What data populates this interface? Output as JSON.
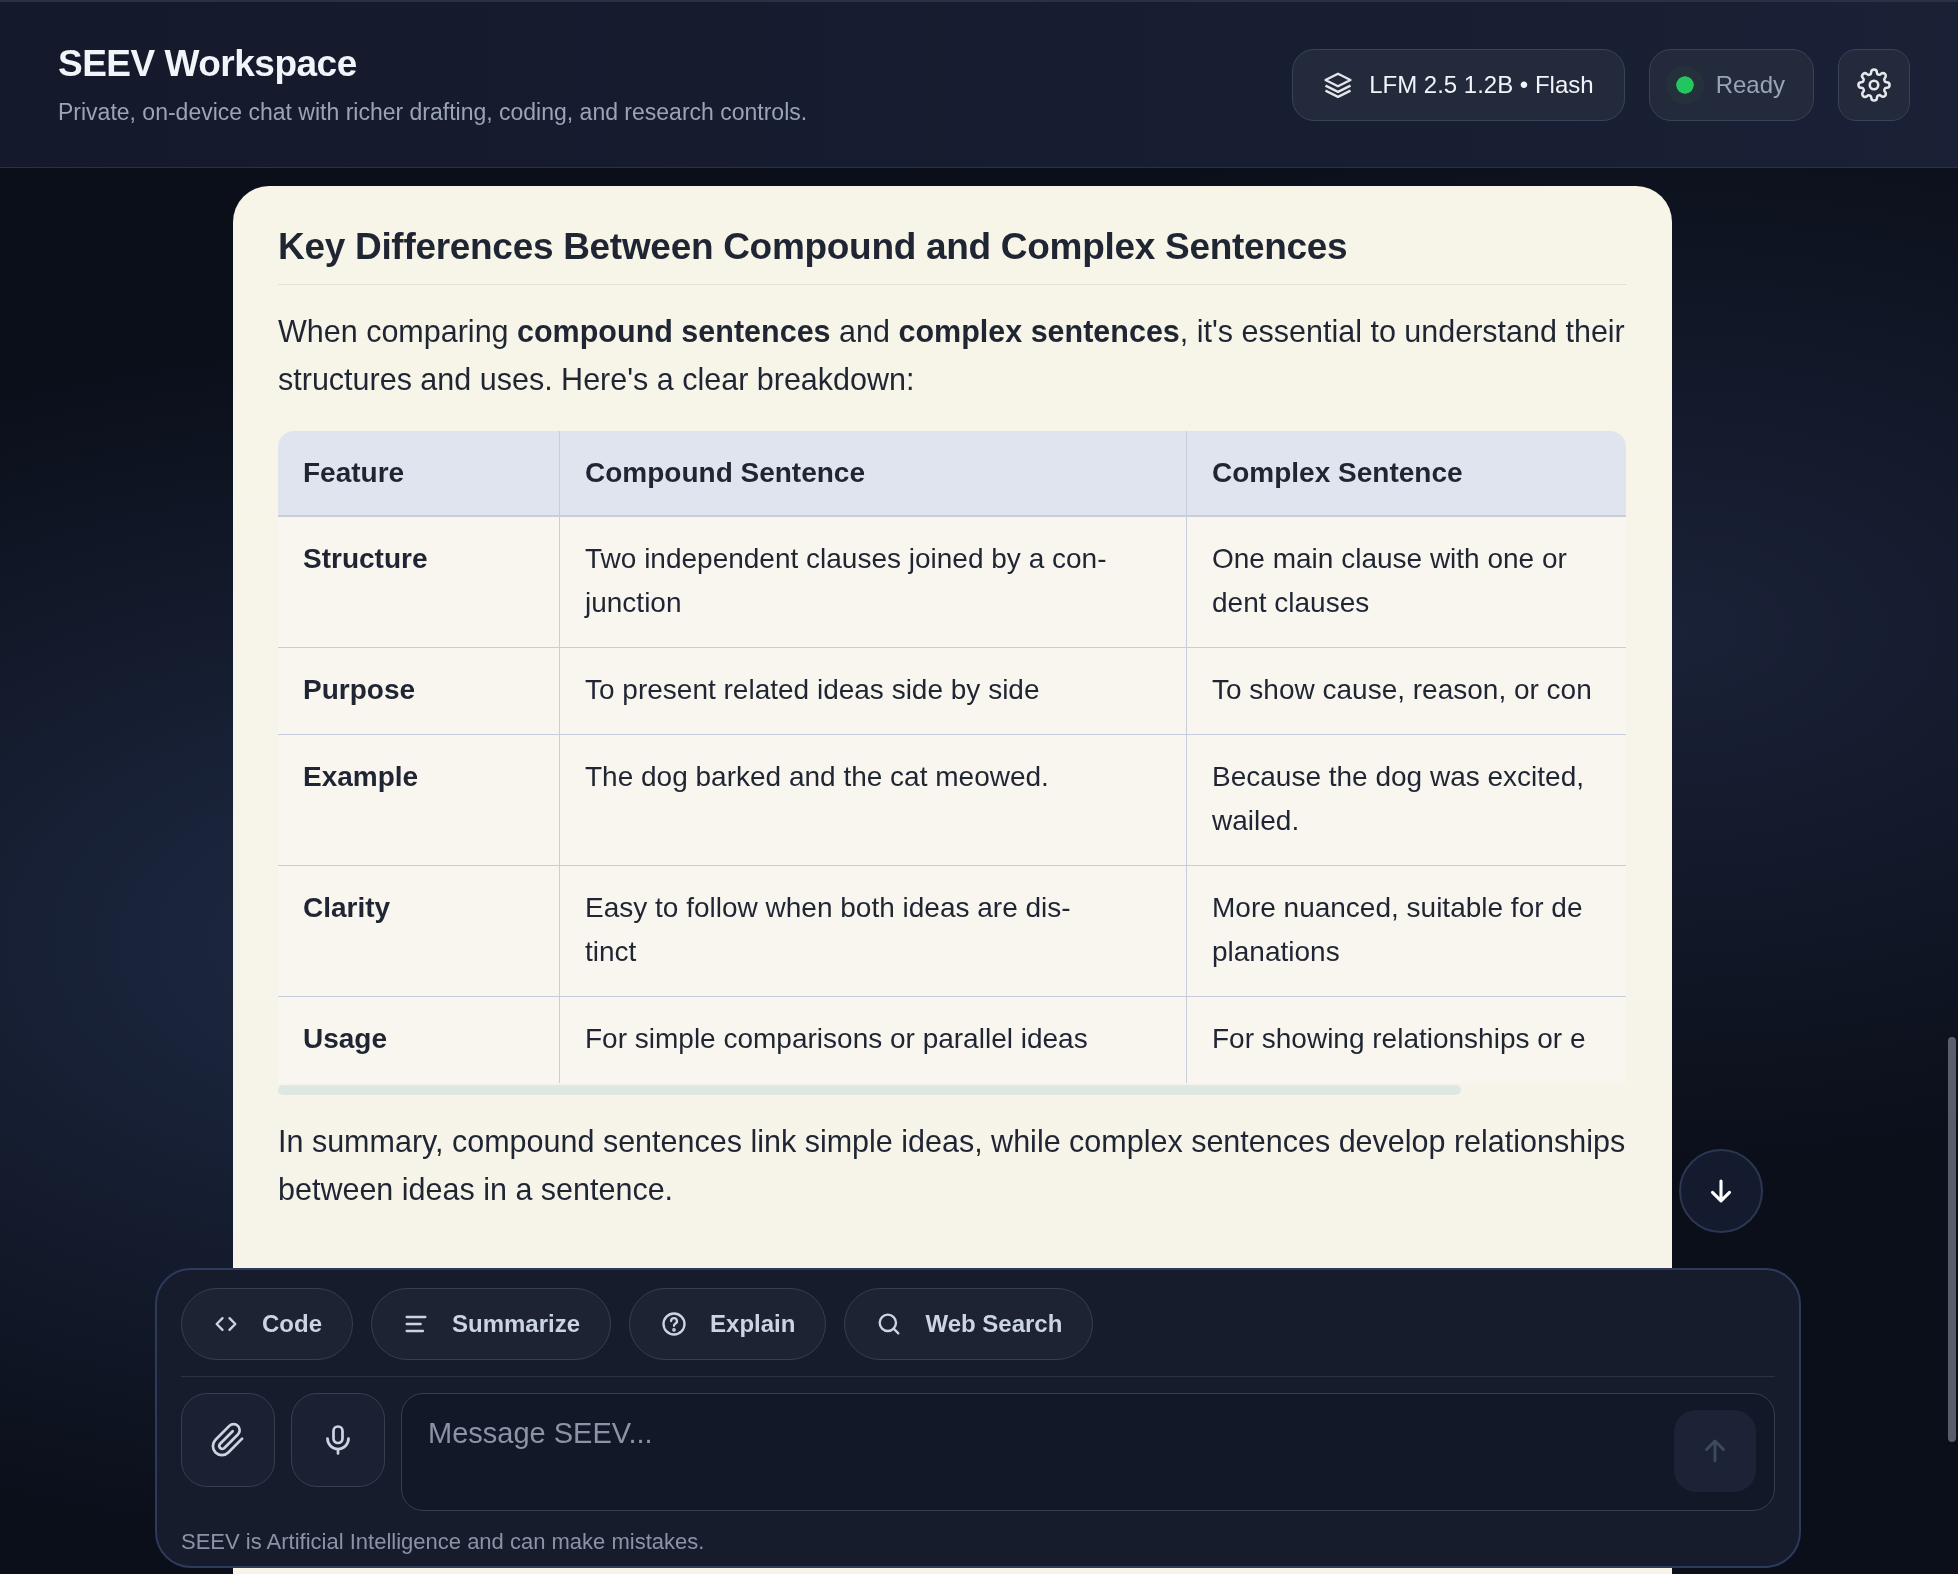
{
  "header": {
    "title": "SEEV Workspace",
    "subtitle": "Private, on-device chat with richer drafting, coding, and research controls.",
    "model": "LFM 2.5 1.2B • Flash",
    "status": {
      "label": "Ready",
      "online": true
    }
  },
  "message": {
    "heading": "Key Differences Between Compound and Complex Sentences",
    "intro": "When comparing **compound sentences** and **complex sentences**, it's essential to understand their structures and uses. Here's a clear breakdown:",
    "table": {
      "columns": [
        "Feature",
        "Compound Sentence",
        "Complex Sentence"
      ],
      "rows": [
        {
          "feature": "Structure",
          "compound": "Two independent clauses joined by a con-\njunction",
          "complex": "One main clause with one or\ndent clauses"
        },
        {
          "feature": "Purpose",
          "compound": "To present related ideas side by side",
          "complex": "To show cause, reason, or con"
        },
        {
          "feature": "Example",
          "compound": "The dog barked and the cat meowed.",
          "complex": "Because the dog was excited,\nwailed."
        },
        {
          "feature": "Clarity",
          "compound": "Easy to follow when both ideas are dis-\ntinct",
          "complex": "More nuanced, suitable for de\nplanations"
        },
        {
          "feature": "Usage",
          "compound": "For simple comparisons or parallel ideas",
          "complex": "For showing relationships or e"
        }
      ]
    },
    "summary": "In summary, compound sentences link simple ideas, while complex sentences develop relationships between ideas in a sentence."
  },
  "composer": {
    "actions": [
      {
        "kind": "code",
        "label": "Code"
      },
      {
        "kind": "summarize",
        "label": "Summarize"
      },
      {
        "kind": "explain",
        "label": "Explain"
      },
      {
        "kind": "search",
        "label": "Web Search"
      }
    ],
    "placeholder": "Message SEEV...",
    "send_disabled": true,
    "disclaimer": "SEEV is Artificial Intelligence and can make mistakes."
  }
}
